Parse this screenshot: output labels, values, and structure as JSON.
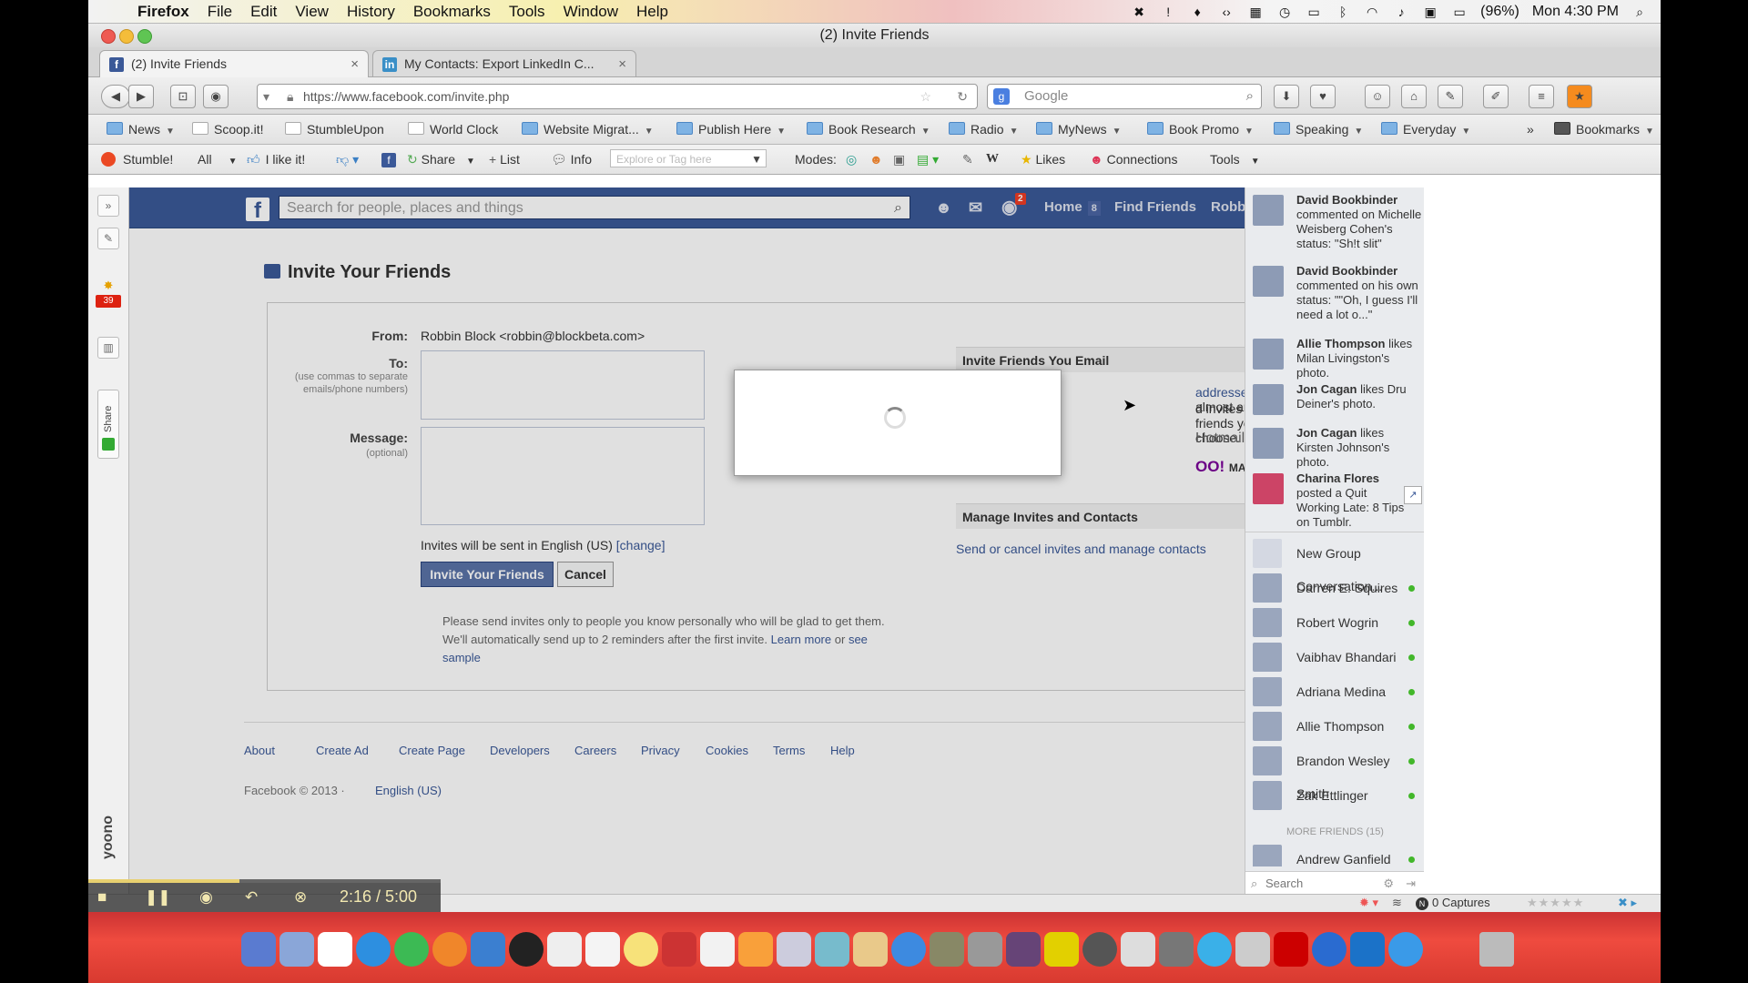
{
  "menubar": {
    "app": "Firefox",
    "items": [
      "File",
      "Edit",
      "View",
      "History",
      "Bookmarks",
      "Tools",
      "Window",
      "Help"
    ],
    "battery": "(96%)",
    "clock": "Mon 4:30 PM"
  },
  "window": {
    "title": "(2) Invite Friends"
  },
  "tabs": [
    {
      "label": "(2) Invite Friends",
      "active": true,
      "icon": "facebook-icon"
    },
    {
      "label": "My Contacts: Export LinkedIn C...",
      "active": false,
      "icon": "linkedin-icon"
    }
  ],
  "nav": {
    "url": "https://www.facebook.com/invite.php",
    "url_domain": "facebook.com",
    "search_placeholder": "Google"
  },
  "bookmarks": {
    "items": [
      "News",
      "Scoop.it!",
      "StumbleUpon",
      "World Clock",
      "Website Migrat...",
      "Publish Here",
      "Book Research",
      "Radio",
      "MyNews",
      "Book Promo",
      "Speaking",
      "Everyday"
    ],
    "overflow": "»",
    "menu": "Bookmarks"
  },
  "stumblebar": {
    "stumble": "Stumble!",
    "all": "All",
    "ilike": "I like it!",
    "share": "Share",
    "list": "List",
    "info": "Info",
    "explore_placeholder": "Explore or Tag here",
    "modes": "Modes:",
    "likes": "Likes",
    "connections": "Connections",
    "tools": "Tools"
  },
  "leftstrip": {
    "badge": "39",
    "share": "Share",
    "yoono": "yoono"
  },
  "facebook": {
    "search_placeholder": "Search for people, places and things",
    "notif_count": "2",
    "home": "Home",
    "home_count": "8",
    "find_friends": "Find Friends",
    "user": "Robbin"
  },
  "invite": {
    "heading": "Invite Your Friends",
    "from_label": "From:",
    "from_value": "Robbin Block <robbin@blockbeta.com>",
    "to_label": "To:",
    "to_hint": "(use commas to separate emails/phone numbers)",
    "message_label": "Message:",
    "message_hint": "(optional)",
    "lang_note": "Invites will be sent in English (US)",
    "change": "[change]",
    "invite_button": "Invite Your Friends",
    "cancel_button": "Cancel",
    "disclaimer_1": "Please send invites only to people you know personally who will be glad to get them. We'll automatically send up to 2 reminders after the first invite.",
    "learn": "Learn more",
    "or": "or",
    "see_sample": "see sample",
    "email_section": "Invite Friends You Email",
    "email_text_link": "addresses",
    "email_text_1": "from almost any",
    "email_text_2": "d invites to the friends you choose.",
    "hotmail": "Hotmail",
    "yahoo": "OO!",
    "yahoo_mail": "MAIL",
    "manage_section": "Manage Invites and Contacts",
    "manage_link": "Send or cancel invites and manage contacts"
  },
  "footer": {
    "links": [
      "About",
      "Create Ad",
      "Create Page",
      "Developers",
      "Careers",
      "Privacy",
      "Cookies",
      "Terms",
      "Help"
    ],
    "copyright": "Facebook © 2013 ·",
    "language": "English (US)"
  },
  "ticker": [
    {
      "name": "David Bookbinder",
      "text": "commented on Michelle Weisberg Cohen's status: \"Sh!t slit\""
    },
    {
      "name": "David Bookbinder",
      "text": "commented on his own status: \"\"Oh, I guess I'll need a lot o...\""
    },
    {
      "name": "Allie Thompson",
      "text": "likes Milan Livingston's photo."
    },
    {
      "name": "Jon Cagan",
      "text": "likes Dru Deiner's photo."
    },
    {
      "name": "Jon Cagan",
      "text": "likes Kirsten Johnson's photo."
    },
    {
      "name": "Charina Flores",
      "text": "posted a Quit Working Late: 8 Tips on Tumblr."
    }
  ],
  "chat": {
    "new_group": "New Group Conversation...",
    "friends": [
      "Darren E. Squires",
      "Robert Wogrin",
      "Vaibhav Bhandari",
      "Adriana Medina",
      "Allie Thompson",
      "Brandon Wesley Smith",
      "Zak Ettlinger"
    ],
    "more_friends": "MORE FRIENDS (15)",
    "more_list": [
      "Andrew Ganfield"
    ],
    "search": "Search"
  },
  "statusbar": {
    "captures": "0 Captures"
  },
  "video": {
    "time": "2:16 / 5:00",
    "progress": 0.43
  },
  "colors": {
    "fb_blue": "#3b5998",
    "dock_red": "#e8443a",
    "online": "#42b72a"
  }
}
